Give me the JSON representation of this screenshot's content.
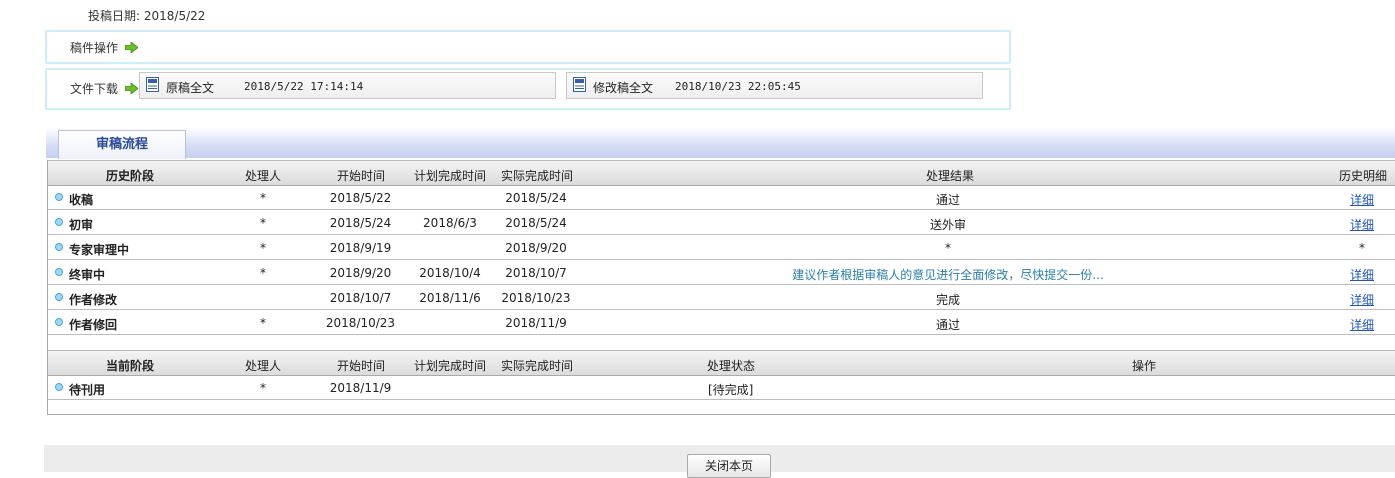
{
  "submit_date": {
    "label": "投稿日期:",
    "value": "2018/5/22"
  },
  "manuscript_ops": {
    "label": "稿件操作"
  },
  "file_download": {
    "label": "文件下载",
    "files": [
      {
        "name": "原稿全文",
        "date": "2018/5/22 17:14:14"
      },
      {
        "name": "修改稿全文",
        "date": "2018/10/23 22:05:45"
      }
    ]
  },
  "review_tab": {
    "label": "审稿流程"
  },
  "history": {
    "headers": [
      "历史阶段",
      "处理人",
      "开始时间",
      "计划完成时间",
      "实际完成时间",
      "处理结果",
      "历史明细"
    ],
    "rows": [
      {
        "stage": "收稿",
        "handler": "*",
        "start": "2018/5/22",
        "planned": "",
        "actual": "2018/5/24",
        "result": "通过",
        "detail": "详细"
      },
      {
        "stage": "初审",
        "handler": "*",
        "start": "2018/5/24",
        "planned": "2018/6/3",
        "actual": "2018/5/24",
        "result": "送外审",
        "detail": "详细"
      },
      {
        "stage": "专家审理中",
        "handler": "*",
        "start": "2018/9/19",
        "planned": "",
        "actual": "2018/9/20",
        "result": "*",
        "detail": "*"
      },
      {
        "stage": "终审中",
        "handler": "*",
        "start": "2018/9/20",
        "planned": "2018/10/4",
        "actual": "2018/10/7",
        "result": "建议作者根据审稿人的意见进行全面修改，尽快提交一份...",
        "detail": "详细"
      },
      {
        "stage": "作者修改",
        "handler": "",
        "start": "2018/10/7",
        "planned": "2018/11/6",
        "actual": "2018/10/23",
        "result": "完成",
        "detail": "详细"
      },
      {
        "stage": "作者修回",
        "handler": "*",
        "start": "2018/10/23",
        "planned": "",
        "actual": "2018/11/9",
        "result": "通过",
        "detail": "详细"
      }
    ]
  },
  "current": {
    "headers": [
      "当前阶段",
      "处理人",
      "开始时间",
      "计划完成时间",
      "实际完成时间",
      "处理状态",
      "操作"
    ],
    "rows": [
      {
        "stage": "待刊用",
        "handler": "*",
        "start": "2018/11/9",
        "planned": "",
        "actual": "",
        "status": "[待完成]",
        "action": ""
      }
    ]
  },
  "close_button": {
    "label": "关闭本页"
  },
  "colors": {
    "tab_text": "#2a4a98",
    "link": "#2255bb",
    "box_border": "#cdeef5",
    "bullet": "#9fd7f5"
  },
  "icons": [
    "right-arrow-icon",
    "word-document-icon",
    "bullet-icon"
  ]
}
